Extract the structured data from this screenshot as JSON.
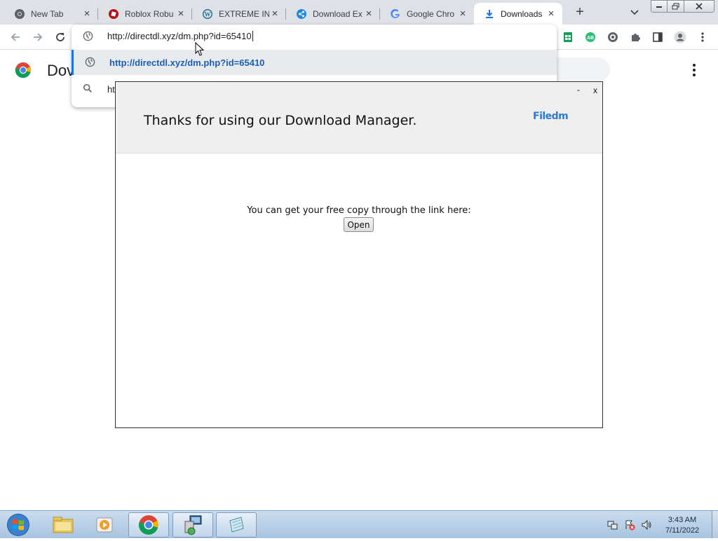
{
  "browser": {
    "tabs": [
      {
        "title": "New Tab",
        "icon": "chrome-icon"
      },
      {
        "title": "Roblox Robu",
        "icon": "roblox-icon"
      },
      {
        "title": "EXTREME IN",
        "icon": "wordpress-icon"
      },
      {
        "title": "Download Ex",
        "icon": "share-icon"
      },
      {
        "title": "Google Chro",
        "icon": "google-icon"
      },
      {
        "title": "Downloads",
        "icon": "download-icon",
        "active": true
      }
    ],
    "address": {
      "value": "http://directdl.xyz/dm.php?id=65410"
    },
    "suggestions": [
      {
        "text": "http://directdl.xyz/dm.php?id=65410",
        "icon": "globe-icon"
      },
      {
        "text": "ht",
        "icon": "search-icon"
      }
    ]
  },
  "page": {
    "title": "Dov"
  },
  "popup": {
    "title": "Thanks for using our Download Manager.",
    "brand": "Filedm",
    "minimize": "-",
    "close": "x",
    "message": "You can get your free copy through the link here:",
    "open_button": "Open"
  },
  "taskbar": {
    "time": "3:43 AM",
    "date": "7/11/2022"
  },
  "colors": {
    "accent": "#1a73e8",
    "brand": "#2b7bd6",
    "tabstrip": "#dee1e6"
  }
}
